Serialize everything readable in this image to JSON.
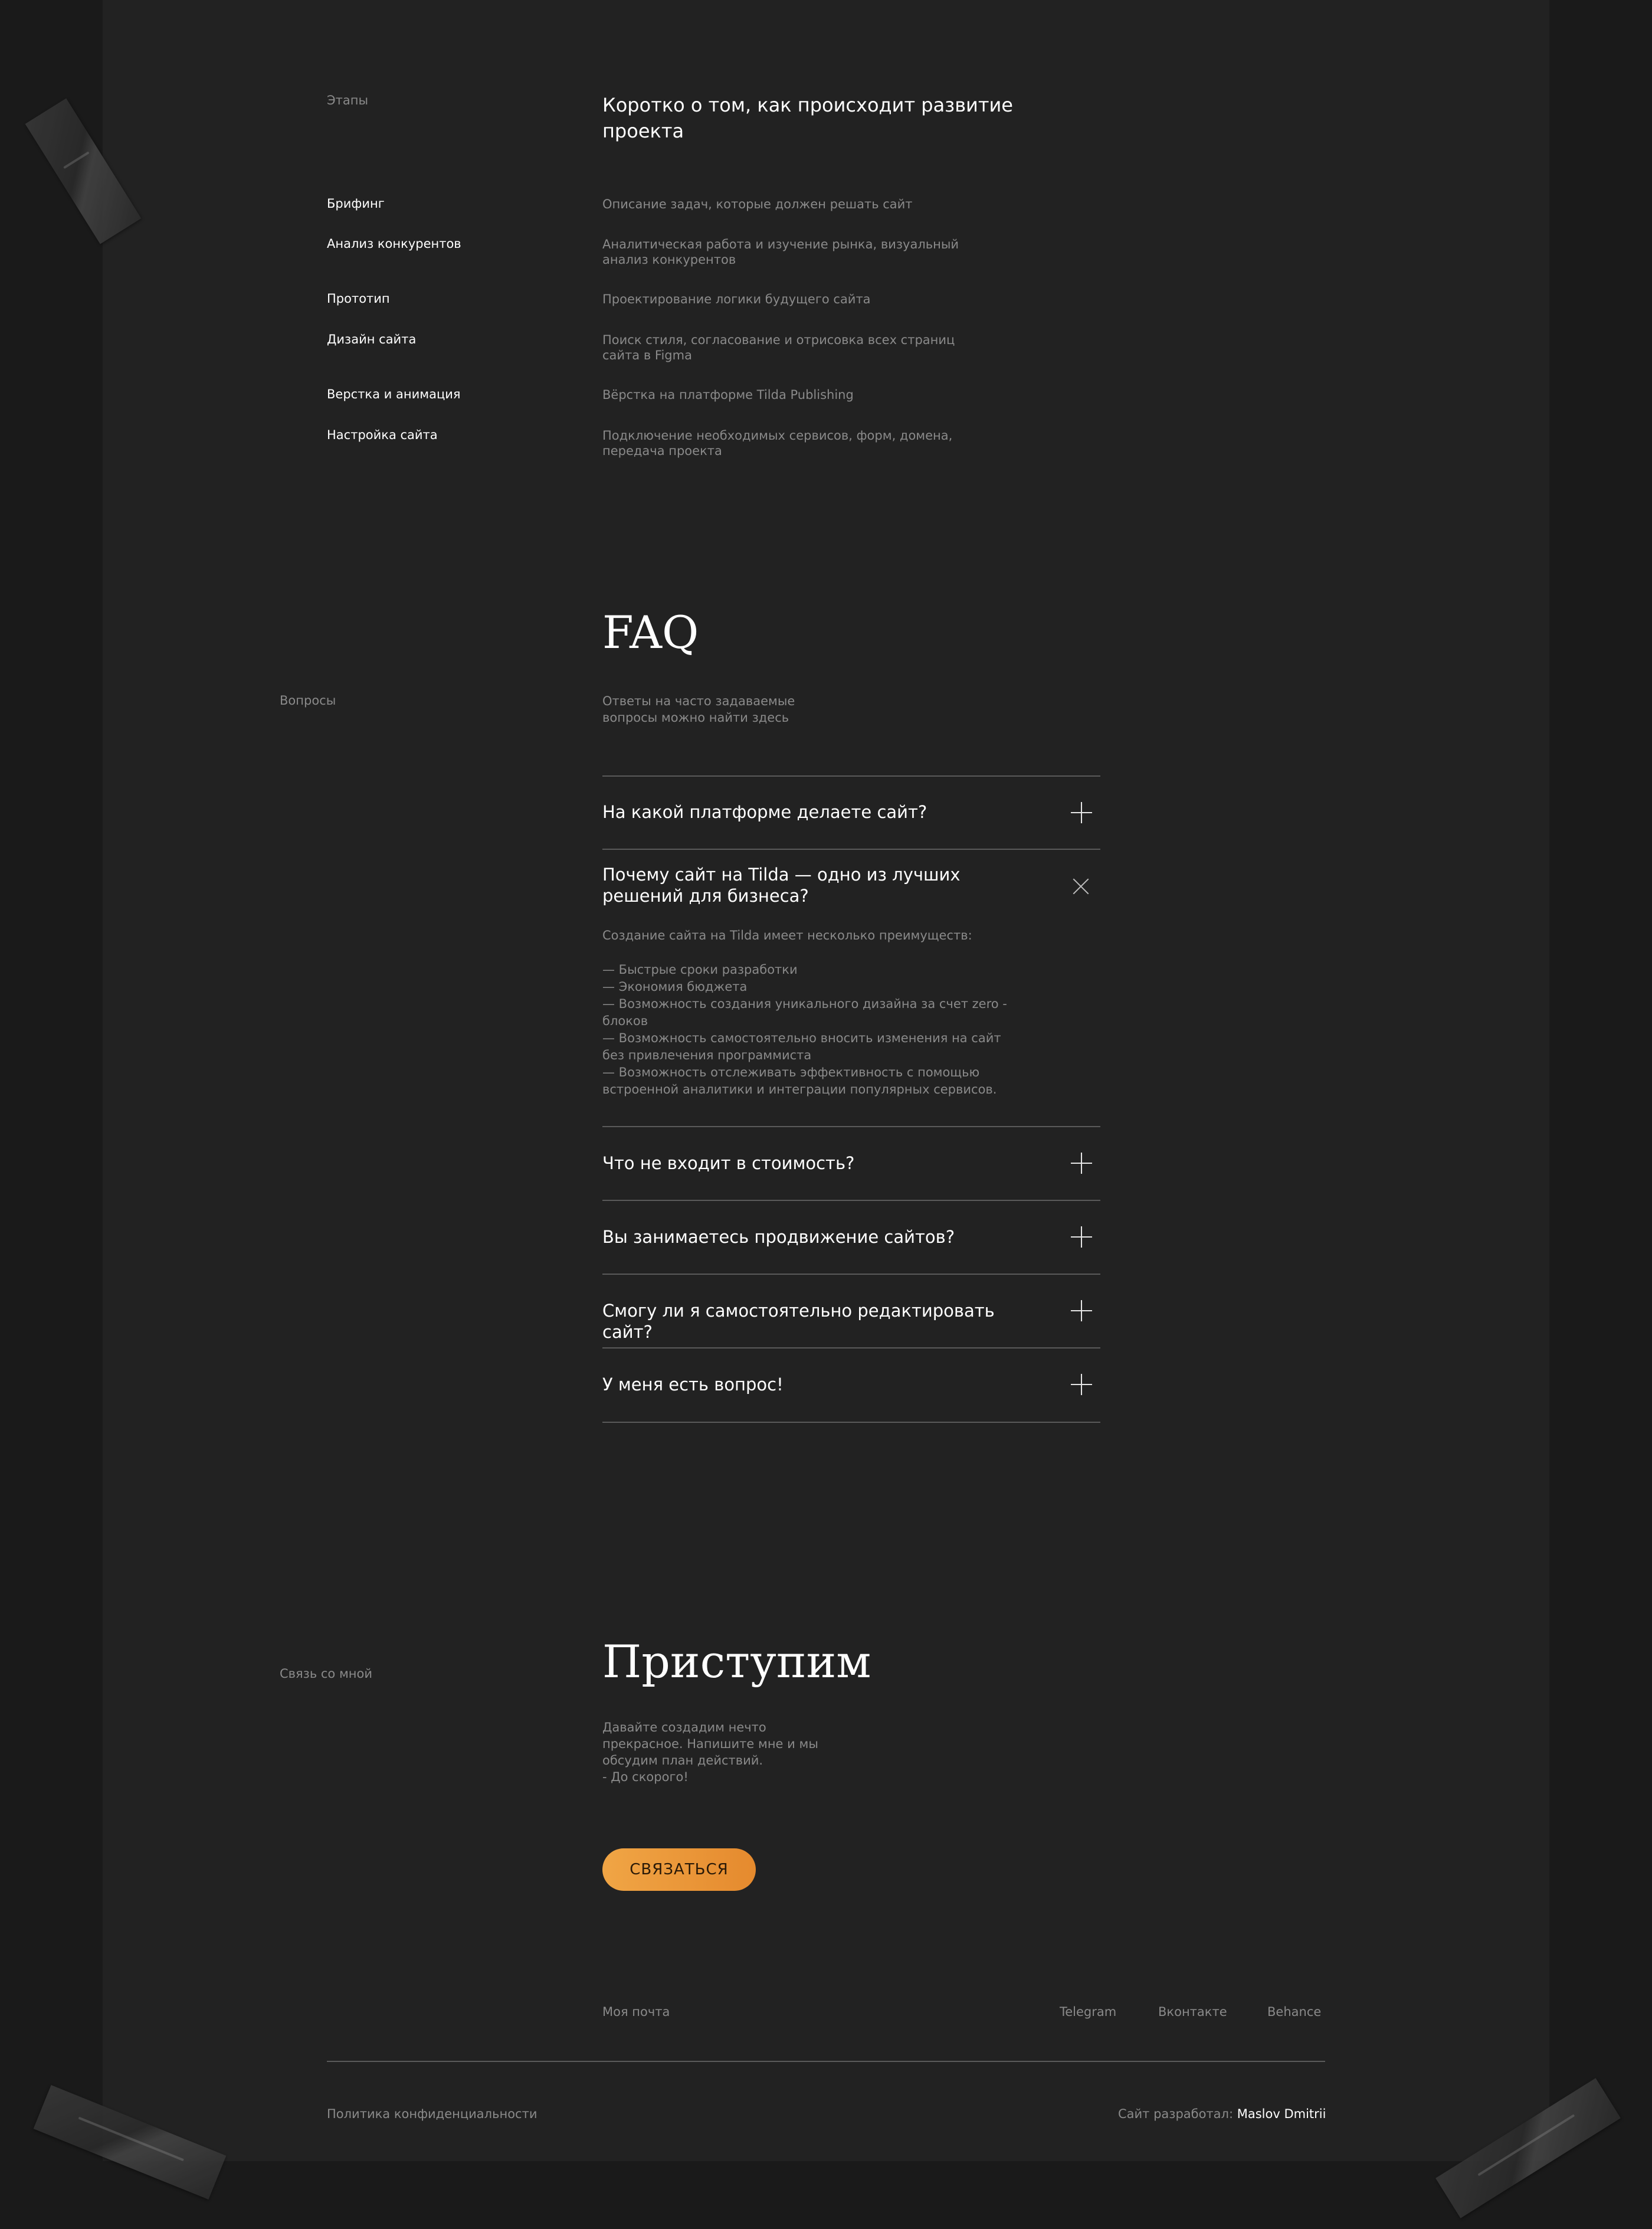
{
  "stages": {
    "label": "Этапы",
    "heading": "Коротко о том, как происходит развитие проекта",
    "items": [
      {
        "name": "Брифинг",
        "desc": "Описание задач, которые должен решать сайт"
      },
      {
        "name": "Анализ конкурентов",
        "desc": "Аналитическая работа и изучение рынка, визуальный анализ конкурентов"
      },
      {
        "name": "Прототип",
        "desc": "Проектирование логики будущего сайта"
      },
      {
        "name": "Дизайн сайта",
        "desc": "Поиск стиля, согласование и отрисовка всех страниц сайта в Figma"
      },
      {
        "name": "Верстка и анимация",
        "desc": "Вёрстка на платформе Tilda Publishing"
      },
      {
        "name": "Настройка сайта",
        "desc": "Подключение необходимых сервисов, форм, домена, передача проекта"
      }
    ]
  },
  "faq": {
    "label": "Вопросы",
    "title": "FAQ",
    "subtitle_line1": "Ответы на часто задаваемые",
    "subtitle_line2": "вопросы можно найти здесь",
    "items": [
      {
        "question": "На какой платформе делаете сайт?",
        "icon": "plus-icon"
      },
      {
        "question": "Почему сайт на Tilda — одно из лучших решений для бизнеса?",
        "icon": "close-icon",
        "answer_intro": "Создание сайта на Tilda имеет несколько преимуществ:",
        "answer_points": [
          "— Быстрые сроки разработки",
          "— Экономия бюджета",
          "— Возможность создания уникального дизайна за счет zero - блоков",
          "— Возможность самостоятельно вносить изменения на сайт без привлечения программиста",
          "— Возможность отслеживать эффективность с помощью встроенной аналитики и интеграции популярных сервисов."
        ]
      },
      {
        "question": "Что не входит в стоимость?",
        "icon": "plus-icon"
      },
      {
        "question": "Вы занимаетесь продвижение сайтов?",
        "icon": "plus-icon"
      },
      {
        "question": "Смогу ли я самостоятельно редактировать сайт?",
        "icon": "plus-icon"
      },
      {
        "question": "У меня есть вопрос!",
        "icon": "plus-icon"
      }
    ]
  },
  "contact": {
    "label": "Связь со мной",
    "title": "Приступим",
    "text_lines": [
      "Давайте создадим нечто",
      "прекрасное. Напишите мне и мы",
      "обсудим план действий.",
      "- До скорого!"
    ],
    "button": "СВЯЗАТЬСЯ"
  },
  "footer": {
    "email_link": "Моя почта",
    "links": [
      "Telegram",
      "Вконтакте",
      "Behance"
    ],
    "privacy": "Политика конфиденциальности",
    "credit_prefix": "Сайт разработал:",
    "credit_name": "Maslov Dmitrii"
  },
  "colors": {
    "background": "#1a1a1a",
    "paper": "#222222",
    "accent": "#f0a545",
    "muted_text": "#8a8a8a",
    "divider": "#5a5a5a"
  }
}
